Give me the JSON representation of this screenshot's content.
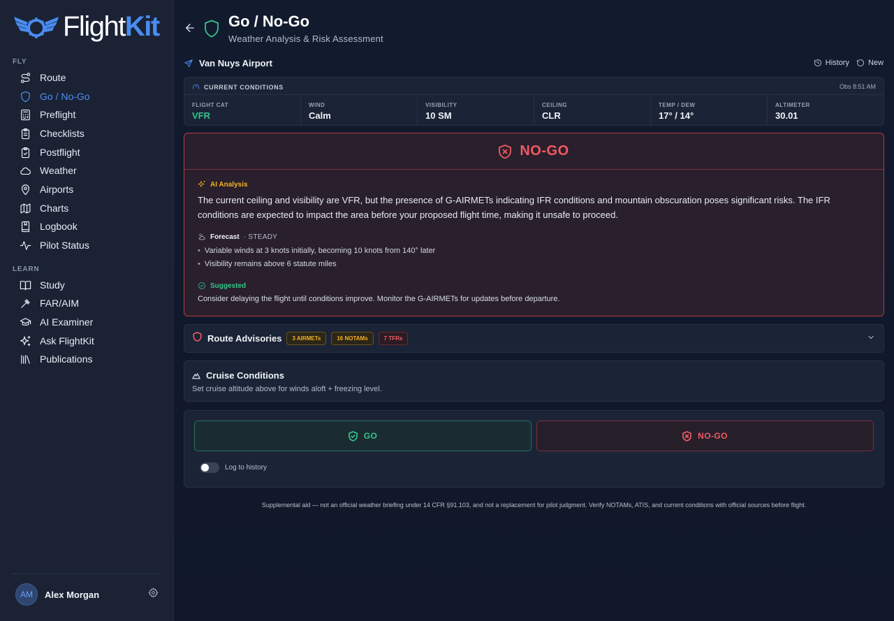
{
  "app": {
    "logo_prefix": "Flight",
    "logo_suffix": "Kit"
  },
  "sidebar": {
    "fly_label": "FLY",
    "learn_label": "LEARN",
    "fly_items": [
      {
        "label": "Route",
        "icon": "route-icon"
      },
      {
        "label": "Go / No-Go",
        "icon": "shield-icon",
        "active": true
      },
      {
        "label": "Preflight",
        "icon": "calculator-icon"
      },
      {
        "label": "Checklists",
        "icon": "clipboard-list-icon"
      },
      {
        "label": "Postflight",
        "icon": "clipboard-check-icon"
      },
      {
        "label": "Weather",
        "icon": "cloud-icon"
      },
      {
        "label": "Airports",
        "icon": "map-pin-icon"
      },
      {
        "label": "Charts",
        "icon": "map-icon"
      },
      {
        "label": "Logbook",
        "icon": "logbook-icon"
      },
      {
        "label": "Pilot Status",
        "icon": "activity-icon"
      }
    ],
    "learn_items": [
      {
        "label": "Study",
        "icon": "book-open-icon"
      },
      {
        "label": "FAR/AIM",
        "icon": "gavel-icon"
      },
      {
        "label": "AI Examiner",
        "icon": "graduation-cap-icon"
      },
      {
        "label": "Ask FlightKit",
        "icon": "sparkles-icon"
      },
      {
        "label": "Publications",
        "icon": "library-icon"
      }
    ],
    "user": {
      "initials": "AM",
      "name": "Alex Morgan"
    }
  },
  "header": {
    "title": "Go / No-Go",
    "subtitle": "Weather Analysis & Risk Assessment"
  },
  "airport": {
    "name": "Van Nuys Airport"
  },
  "actions": {
    "history": "History",
    "new": "New"
  },
  "conditions": {
    "heading": "CURRENT CONDITIONS",
    "obs_time": "Obs 8:51 AM",
    "cells": [
      {
        "label": "FLIGHT CAT",
        "value": "VFR"
      },
      {
        "label": "WIND",
        "value": "Calm"
      },
      {
        "label": "VISIBILITY",
        "value": "10 SM"
      },
      {
        "label": "CEILING",
        "value": "CLR"
      },
      {
        "label": "TEMP / DEW",
        "value": "17° / 14°"
      },
      {
        "label": "ALTIMETER",
        "value": "30.01"
      }
    ]
  },
  "verdict": {
    "label": "NO-GO",
    "ai_heading": "AI Analysis",
    "ai_text": "The current ceiling and visibility are VFR, but the presence of G-AIRMETs indicating IFR conditions and mountain obscuration poses significant risks. The IFR conditions are expected to impact the area before your proposed flight time, making it unsafe to proceed.",
    "forecast_label": "Forecast",
    "forecast_trend": "· STEADY",
    "forecast_items": [
      "Variable winds at 3 knots initially, becoming 10 knots from 140° later",
      "Visibility remains above 6 statute miles"
    ],
    "suggested_label": "Suggested",
    "suggested_text": "Consider delaying the flight until conditions improve. Monitor the G-AIRMETs for updates before departure."
  },
  "advisories": {
    "title": "Route Advisories",
    "badges": [
      {
        "label": "3 AIRMETs",
        "tone": "amber"
      },
      {
        "label": "16 NOTAMs",
        "tone": "amber"
      },
      {
        "label": "7 TFRs",
        "tone": "red"
      }
    ]
  },
  "cruise": {
    "title": "Cruise Conditions",
    "subtitle": "Set cruise altitude above for winds aloft + freezing level."
  },
  "decision": {
    "go_label": "GO",
    "nogo_label": "NO-GO",
    "log_label": "Log to history",
    "log_enabled": false
  },
  "disclaimer": "Supplemental aid — not an official weather briefing under 14 CFR §91.103, and not a replacement for pilot judgment. Verify NOTAMs, ATIS, and current conditions with official sources before flight.",
  "colors": {
    "accent": "#4f8ef7",
    "go": "#35c48b",
    "nogo": "#f05a62",
    "amber": "#f5b21e",
    "background": "#0f1728",
    "sidebar": "#1a2234"
  }
}
